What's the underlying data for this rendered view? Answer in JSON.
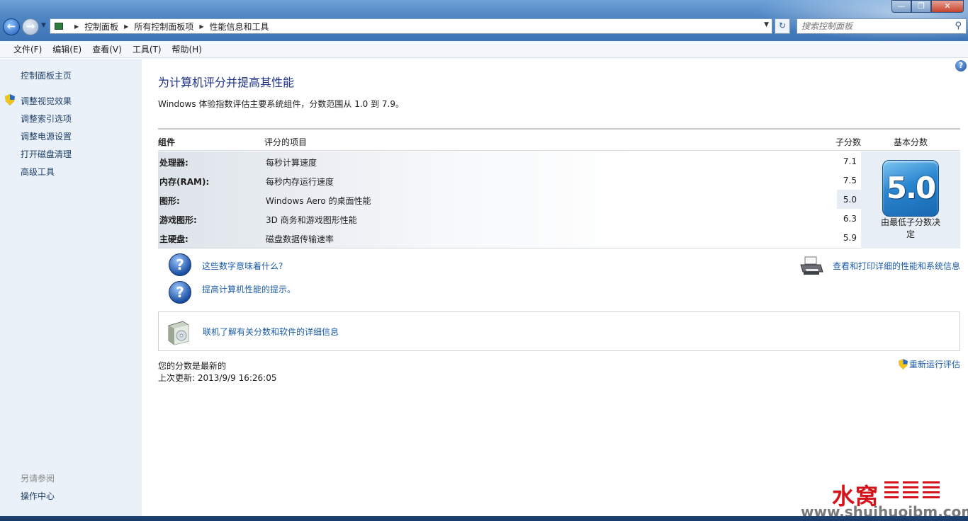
{
  "window": {
    "controls": {
      "minimize": "—",
      "maximize": "❐",
      "close": "✕"
    }
  },
  "navigation": {
    "back_glyph": "←",
    "forward_glyph": "→",
    "breadcrumbs": [
      "控制面板",
      "所有控制面板项",
      "性能信息和工具"
    ],
    "refresh_glyph": "↻"
  },
  "search": {
    "placeholder": "搜索控制面板",
    "icon": "search-icon"
  },
  "menu": {
    "items": [
      "文件(F)",
      "编辑(E)",
      "查看(V)",
      "工具(T)",
      "帮助(H)"
    ]
  },
  "sidebar": {
    "home": "控制面板主页",
    "links": [
      "调整视觉效果",
      "调整索引选项",
      "调整电源设置",
      "打开磁盘清理",
      "高级工具"
    ],
    "see_also_label": "另请参阅",
    "see_also_links": [
      "操作中心"
    ]
  },
  "main": {
    "title": "为计算机评分并提高其性能",
    "description": "Windows 体验指数评估主要系统组件，分数范围从 1.0 到 7.9。",
    "table": {
      "headers": {
        "component": "组件",
        "item": "评分的项目",
        "subscore": "子分数",
        "basescore": "基本分数"
      },
      "rows": [
        {
          "component": "处理器:",
          "item": "每秒计算速度",
          "score": "7.1"
        },
        {
          "component": "内存(RAM):",
          "item": "每秒内存运行速度",
          "score": "7.5"
        },
        {
          "component": "图形:",
          "item": "Windows Aero 的桌面性能",
          "score": "5.0"
        },
        {
          "component": "游戏图形:",
          "item": "3D 商务和游戏图形性能",
          "score": "6.3"
        },
        {
          "component": "主硬盘:",
          "item": "磁盘数据传输速率",
          "score": "5.9"
        }
      ],
      "base_score": "5.0",
      "base_note": "由最低子分数决定"
    },
    "links": {
      "what_mean": "这些数字意味着什么?",
      "tips": "提高计算机性能的提示。",
      "print_details": "查看和打印详细的性能和系统信息",
      "online": "联机了解有关分数和软件的详细信息"
    },
    "status": {
      "current": "您的分数是最新的",
      "last_update": "上次更新: 2013/9/9 16:26:05"
    },
    "rerun": "重新运行评估"
  },
  "watermark": {
    "brand": "水窝",
    "url": "www.shuihuoibm.com"
  },
  "colors": {
    "link": "#1c5da8",
    "title": "#1e3287",
    "badge": "#2a85cf",
    "watermark_red": "#d4141a"
  }
}
